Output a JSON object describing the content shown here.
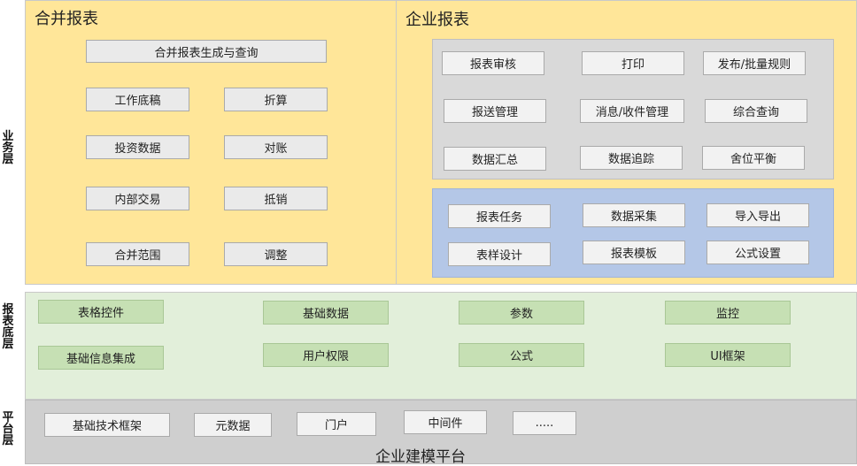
{
  "layers": {
    "business": "业务层",
    "report_base": "报表底层",
    "platform": "平台层"
  },
  "consolidated": {
    "title": "合并报表",
    "items": [
      "合并报表生成与查询",
      "工作底稿",
      "折算",
      "投资数据",
      "对账",
      "内部交易",
      "抵销",
      "合并范围",
      "调整"
    ]
  },
  "enterprise": {
    "title": "企业报表",
    "gray_items": [
      "报表审核",
      "打印",
      "发布/批量规则",
      "报送管理",
      "消息/收件管理",
      "综合查询",
      "数据汇总",
      "数据追踪",
      "舍位平衡"
    ],
    "blue_items": [
      "报表任务",
      "数据采集",
      "导入导出",
      "表样设计",
      "报表模板",
      "公式设置"
    ]
  },
  "base": {
    "items": [
      "表格控件",
      "基础数据",
      "参数",
      "监控",
      "基础信息集成",
      "用户权限",
      "公式",
      "UI框架"
    ]
  },
  "platform": {
    "items": [
      "基础技术框架",
      "元数据",
      "门户",
      "中间件",
      "....."
    ],
    "title": "企业建模平台"
  },
  "colors": {
    "business_bg": "#ffe699",
    "base_bg": "#e2efda",
    "platform_bg": "#d0d0d0",
    "blue_panel": "#b4c7e7",
    "gray_panel": "#d9d9d9",
    "green_box": "#c6e0b4"
  }
}
